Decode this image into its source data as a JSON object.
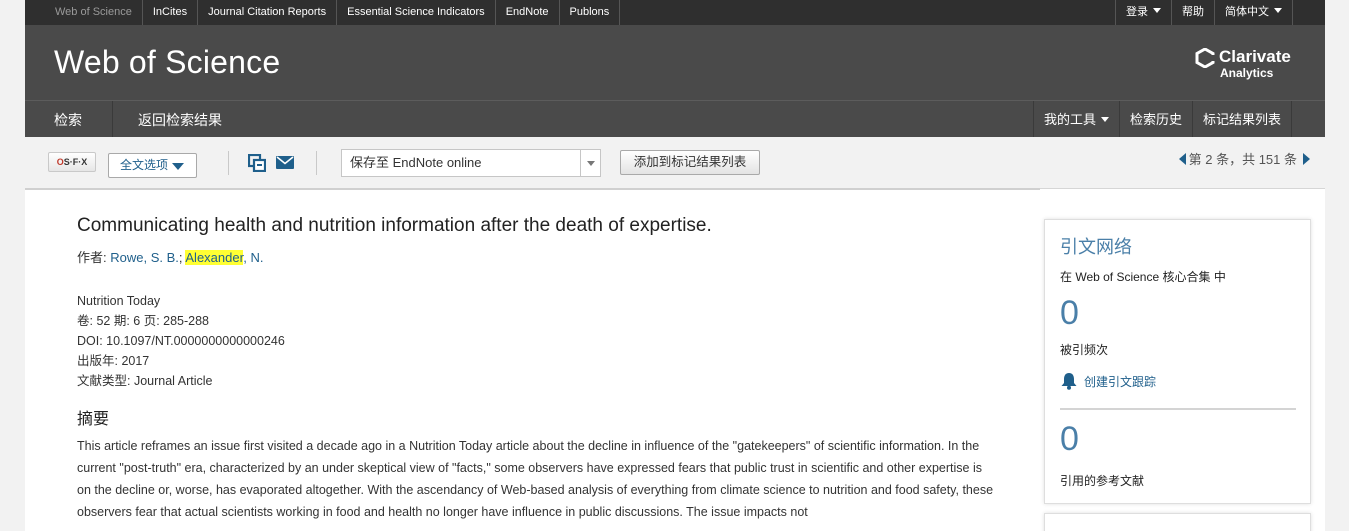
{
  "topbar": {
    "links": [
      "Web of Science",
      "InCites",
      "Journal Citation Reports",
      "Essential Science Indicators",
      "EndNote",
      "Publons"
    ],
    "login": "登录",
    "help": "帮助",
    "language": "简体中文"
  },
  "header": {
    "brand": "Web of Science",
    "clarivate_name": "Clarivate",
    "clarivate_sub": "Analytics"
  },
  "nav": {
    "search": "检索",
    "back": "返回检索结果",
    "my_tools": "我的工具",
    "history": "检索历史",
    "marked_list": "标记结果列表"
  },
  "toolbar": {
    "sfx_label": "S·F·X",
    "fulltext_label": "全文选项",
    "save_select_value": "保存至 EndNote online",
    "add_marked_label": "添加到标记结果列表",
    "pager_text": "第 2 条，共 151 条"
  },
  "record": {
    "title": "Communicating health and nutrition information after the death of expertise.",
    "authors_label": "作者: ",
    "author1": "Rowe, S. B.",
    "author_sep": "; ",
    "author2_highlight": "Alexander",
    "author2_rest": ", N.",
    "journal": "Nutrition Today",
    "volume_line": "卷: 52 期: 6 页: 285-288",
    "doi_line": "DOI: 10.1097/NT.0000000000000246",
    "year_line": "出版年: 2017",
    "doctype_line": "文献类型: Journal Article",
    "abstract_heading": "摘要",
    "abstract_text": "This article reframes an issue first visited a decade ago in a Nutrition Today article about the decline in influence of the \"gatekeepers\" of scientific information. In the current \"post-truth\" era, characterized by an under skeptical view of \"facts,\" some observers have expressed fears that public trust in scientific and other expertise is on the decline or, worse, has evaporated altogether. With the ascendancy of Web-based analysis of everything from climate science to nutrition and food safety, these observers fear that actual scientists working in food and health no longer have influence in public discussions. The issue impacts not"
  },
  "citation_panel": {
    "title": "引文网络",
    "subtitle": "在 Web of Science 核心合集 中",
    "times_cited": "0",
    "times_cited_label": "被引频次",
    "create_alert": "创建引文跟踪",
    "cited_refs": "0",
    "cited_refs_label": "引用的参考文献"
  },
  "colors": {
    "topbar_bg": "#2f2f2f",
    "header_bg": "#4a4a4a",
    "link_blue": "#1f5f8b",
    "accent_blue": "#4a7fa8",
    "highlight": "#ffff33"
  }
}
